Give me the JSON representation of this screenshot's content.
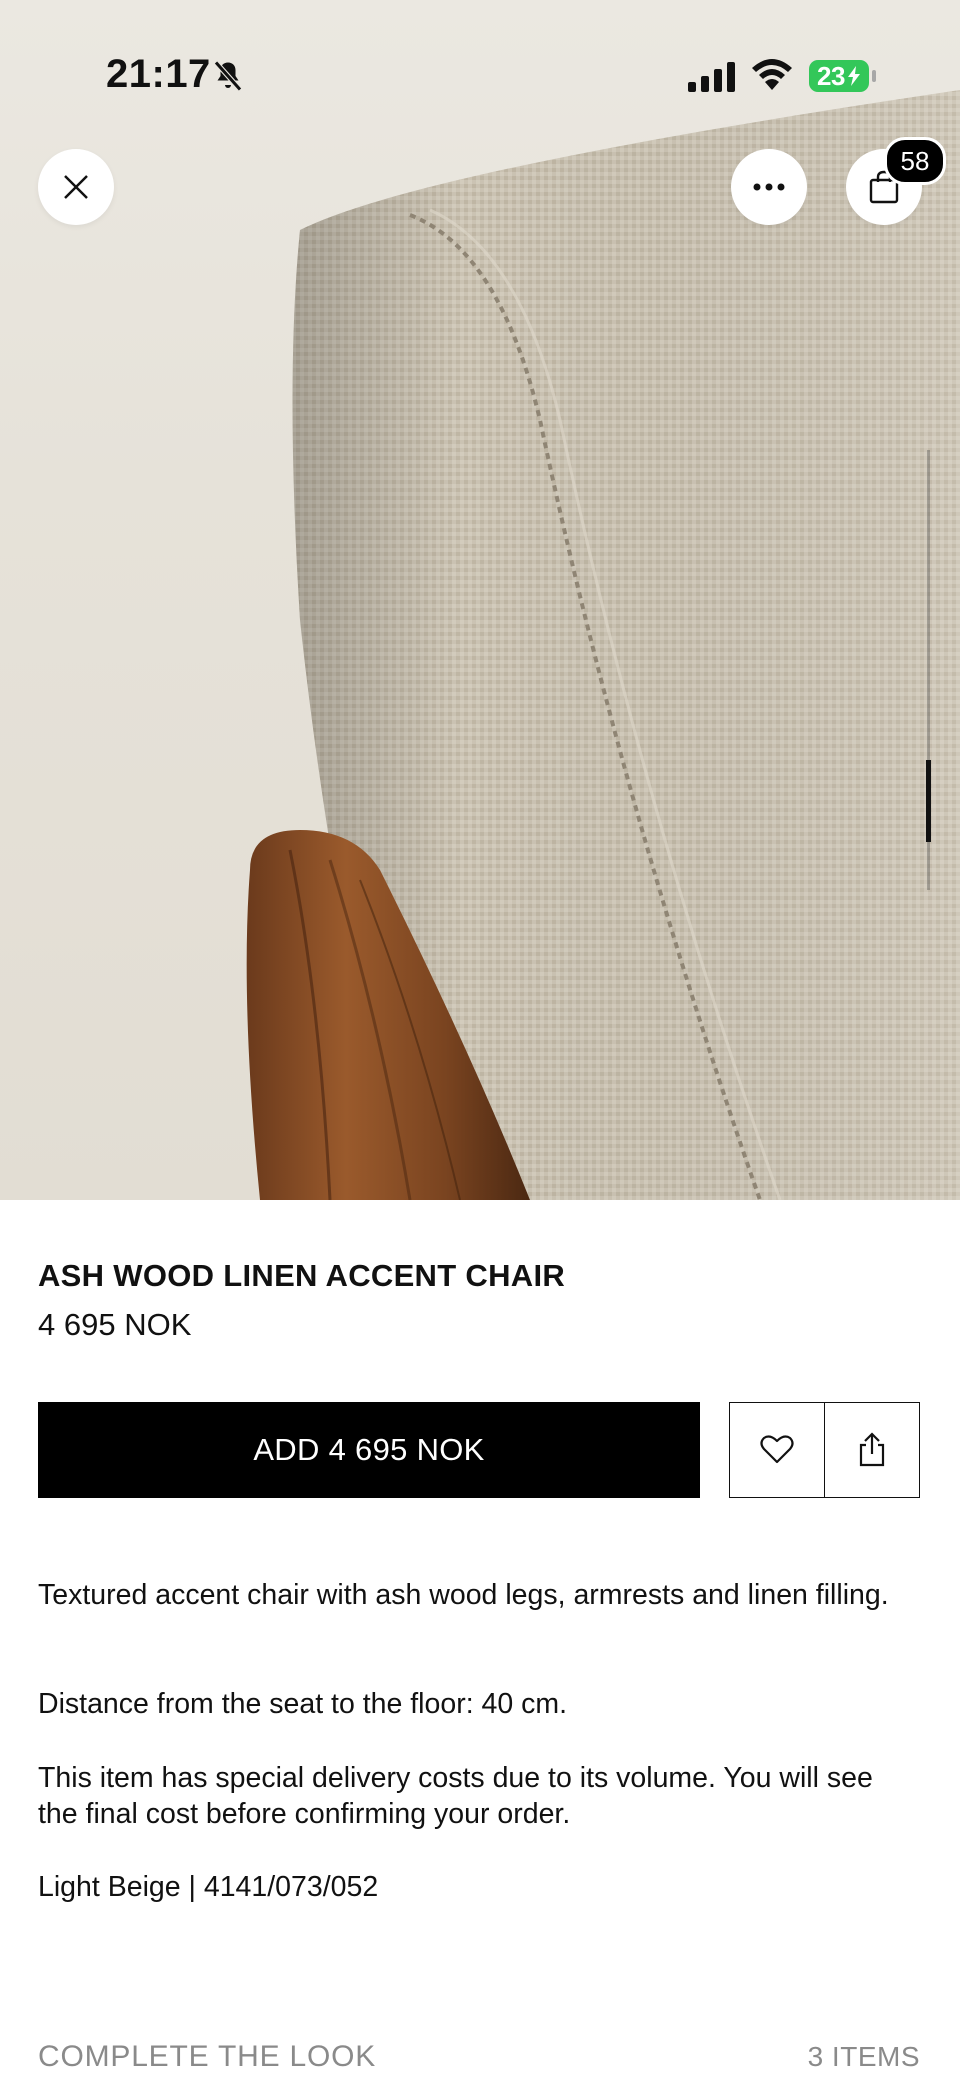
{
  "status_bar": {
    "time": "21:17",
    "battery": "23"
  },
  "header": {
    "bag_count": "58"
  },
  "product": {
    "name": "ASH WOOD LINEN ACCENT CHAIR",
    "price": "4 695 NOK",
    "add_button_label": "ADD 4 695 NOK",
    "description": [
      "Textured accent chair with ash wood legs, armrests and linen filling.",
      "Distance from the seat to the floor: 40 cm.",
      "This item has special delivery costs due to its volume. You will see the final cost before confirming your order.",
      "Light Beige | 4141/073/052"
    ]
  },
  "complete_the_look": {
    "title": "COMPLETE THE LOOK",
    "count": "3 ITEMS"
  },
  "icons": [
    "close-icon",
    "more-icon",
    "shopping-bag-icon",
    "heart-icon",
    "share-icon",
    "bell-slash-icon",
    "signal-icon",
    "wifi-icon",
    "battery-icon"
  ],
  "colors": {
    "primary_button": "#000000",
    "battery_green": "#33c759",
    "muted_text": "#8a8a8a"
  }
}
